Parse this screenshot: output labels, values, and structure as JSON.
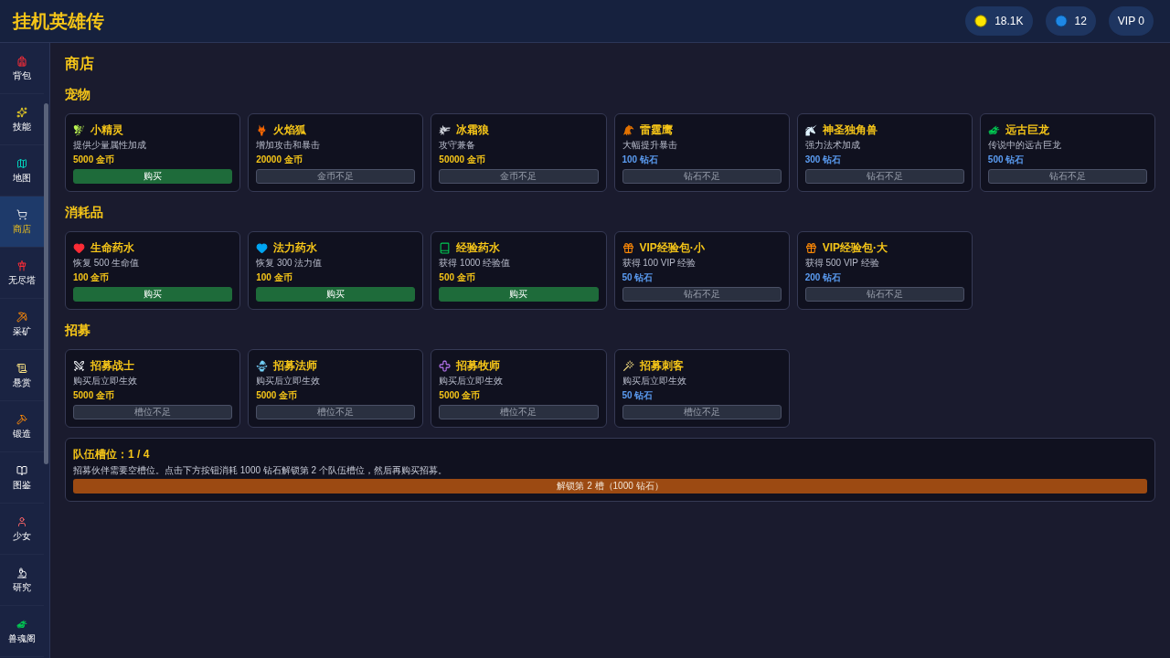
{
  "header": {
    "title": "挂机英雄传",
    "stats": [
      {
        "kind": "gold",
        "value": "18.1K"
      },
      {
        "kind": "diamond",
        "value": "12"
      },
      {
        "kind": "vip",
        "value": "VIP 0"
      }
    ]
  },
  "sidebar": {
    "items": [
      {
        "label": "背包",
        "selected": false
      },
      {
        "label": "技能",
        "selected": false
      },
      {
        "label": "地图",
        "selected": false
      },
      {
        "label": "商店",
        "selected": true
      },
      {
        "label": "无尽塔",
        "selected": false
      },
      {
        "label": "采矿",
        "selected": false
      },
      {
        "label": "悬赏",
        "selected": false
      },
      {
        "label": "锻造",
        "selected": false
      },
      {
        "label": "图鉴",
        "selected": false
      },
      {
        "label": "少女",
        "selected": false
      },
      {
        "label": "研究",
        "selected": false
      },
      {
        "label": "兽魂阁",
        "selected": false
      }
    ]
  },
  "page": {
    "title": "商店",
    "sections": [
      {
        "title": "宠物",
        "items": [
          {
            "name": "小精灵",
            "description": "提供少量属性加成",
            "price": "5000 金币",
            "kind": "gold",
            "button": {
              "label": "购买",
              "disabled": false
            }
          },
          {
            "name": "火焰狐",
            "description": "增加攻击和暴击",
            "price": "20000 金币",
            "kind": "gold",
            "button": {
              "label": "金币不足",
              "disabled": true
            }
          },
          {
            "name": "冰霜狼",
            "description": "攻守兼备",
            "price": "50000 金币",
            "kind": "gold",
            "button": {
              "label": "金币不足",
              "disabled": true
            }
          },
          {
            "name": "雷霆鹰",
            "description": "大幅提升暴击",
            "price": "100 钻石",
            "kind": "diamond",
            "button": {
              "label": "钻石不足",
              "disabled": true
            }
          },
          {
            "name": "神圣独角兽",
            "description": "强力法术加成",
            "price": "300 钻石",
            "kind": "diamond",
            "button": {
              "label": "钻石不足",
              "disabled": true
            }
          },
          {
            "name": "远古巨龙",
            "description": "传说中的远古巨龙",
            "price": "500 钻石",
            "kind": "diamond",
            "button": {
              "label": "钻石不足",
              "disabled": true
            }
          }
        ]
      },
      {
        "title": "消耗品",
        "items": [
          {
            "name": "生命药水",
            "description": "恢复 500 生命值",
            "price": "100 金币",
            "kind": "gold",
            "button": {
              "label": "购买",
              "disabled": false
            }
          },
          {
            "name": "法力药水",
            "description": "恢复 300 法力值",
            "price": "100 金币",
            "kind": "gold",
            "button": {
              "label": "购买",
              "disabled": false
            }
          },
          {
            "name": "经验药水",
            "description": "获得 1000 经验值",
            "price": "500 金币",
            "kind": "gold",
            "button": {
              "label": "购买",
              "disabled": false
            }
          },
          {
            "name": "VIP经验包·小",
            "description": "获得 100 VIP 经验",
            "price": "50 钻石",
            "kind": "diamond",
            "button": {
              "label": "钻石不足",
              "disabled": true
            }
          },
          {
            "name": "VIP经验包·大",
            "description": "获得 500 VIP 经验",
            "price": "200 钻石",
            "kind": "diamond",
            "button": {
              "label": "钻石不足",
              "disabled": true
            }
          }
        ]
      },
      {
        "title": "招募",
        "items": [
          {
            "name": "招募战士",
            "description": "购买后立即生效",
            "price": "5000 金币",
            "kind": "gold",
            "button": {
              "label": "槽位不足",
              "disabled": true
            }
          },
          {
            "name": "招募法师",
            "description": "购买后立即生效",
            "price": "5000 金币",
            "kind": "gold",
            "button": {
              "label": "槽位不足",
              "disabled": true
            }
          },
          {
            "name": "招募牧师",
            "description": "购买后立即生效",
            "price": "5000 金币",
            "kind": "gold",
            "button": {
              "label": "槽位不足",
              "disabled": true
            }
          },
          {
            "name": "招募刺客",
            "description": "购买后立即生效",
            "price": "50 钻石",
            "kind": "diamond",
            "button": {
              "label": "槽位不足",
              "disabled": true
            }
          }
        ]
      }
    ],
    "team_slots": {
      "title": "队伍槽位：1 / 4",
      "description": "招募伙伴需要空槽位。点击下方按钮消耗 1000 钻石解锁第 2 个队伍槽位，然后再购买招募。",
      "button": "解锁第 2 槽（1000 钻石）"
    }
  }
}
